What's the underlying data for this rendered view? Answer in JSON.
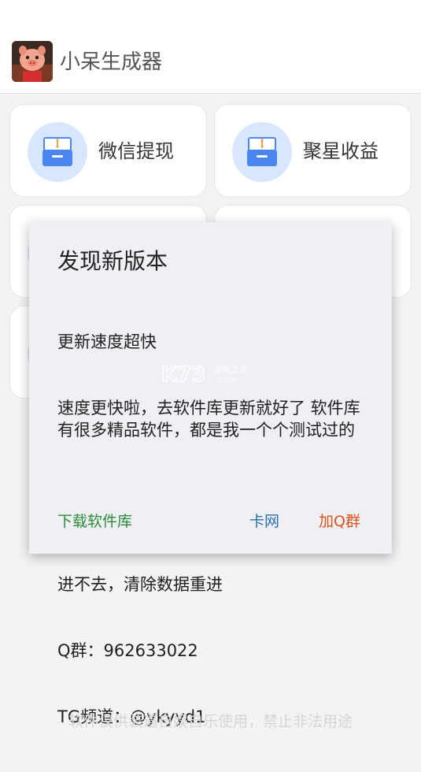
{
  "app": {
    "title": "小呆生成器"
  },
  "cards": [
    {
      "label": "微信提现",
      "icon": "archive-box-icon"
    },
    {
      "label": "聚星收益",
      "icon": "archive-box-icon"
    }
  ],
  "dialog": {
    "title": "发现新版本",
    "line1": "更新速度超快",
    "line2": "速度更快啦，去软件库更新就好了 软件库有很多精品软件，都是我一个个测试过的",
    "line3": "进不去，清除数据重进",
    "line4": "Q群：962633022",
    "line5": "TG频道：@ykyyd1",
    "buttons": {
      "download": "下载软件库",
      "kawang": "卡网",
      "join_group": "加Q群"
    }
  },
  "watermark": {
    "brand": "K73",
    "sub": "游戏之家",
    "domain": ".com"
  },
  "footer": {
    "text": "软件仅供装逼自娱自乐使用，禁止非法用途"
  },
  "colors": {
    "accent_blue": "#4a86f0",
    "icon_circle": "#d9e6ff",
    "download_green": "#2e8b3a",
    "kawang_blue": "#2a6fb0",
    "join_orange": "#d8541c"
  }
}
